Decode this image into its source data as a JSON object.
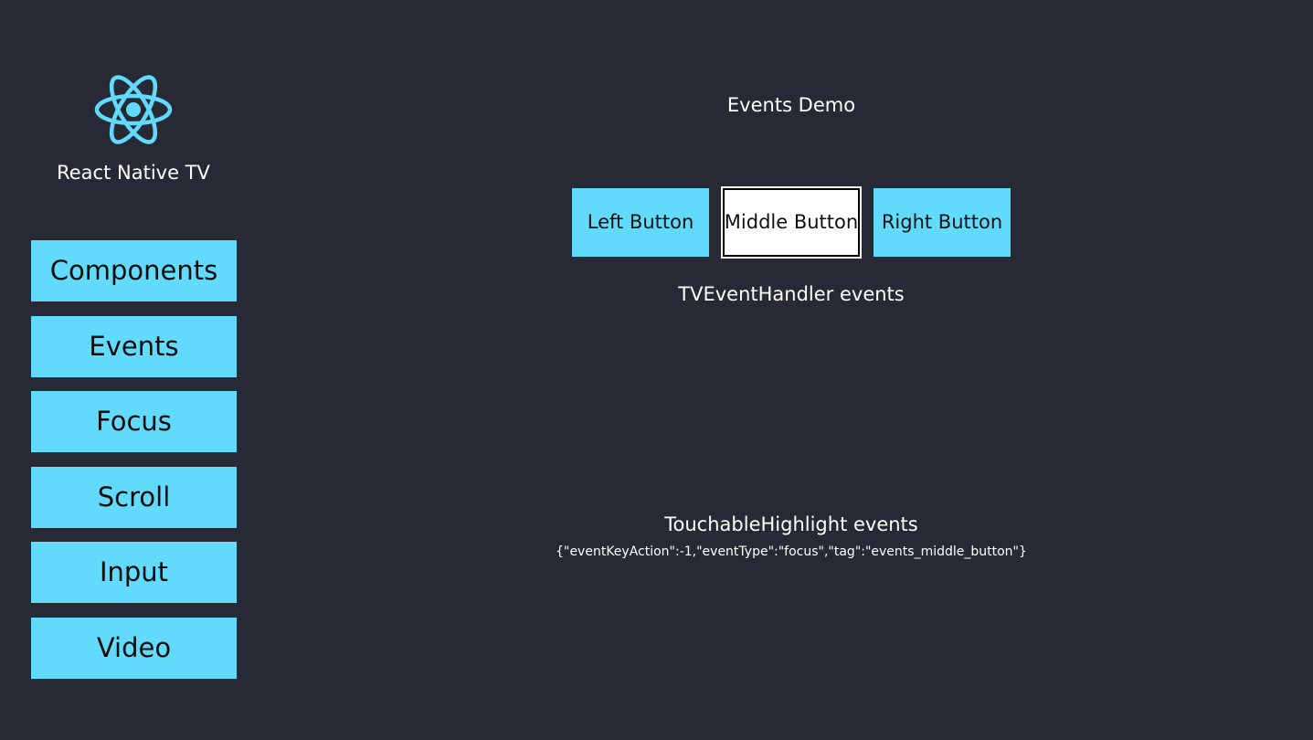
{
  "app": {
    "title": "React Native TV",
    "logo_icon": "react-logo-icon",
    "accent_color": "#61dafb",
    "background_color": "#272a35"
  },
  "sidebar": {
    "items": [
      {
        "label": "Components"
      },
      {
        "label": "Events"
      },
      {
        "label": "Focus"
      },
      {
        "label": "Scroll"
      },
      {
        "label": "Input"
      },
      {
        "label": "Video"
      }
    ]
  },
  "main": {
    "title": "Events Demo",
    "buttons": {
      "left": "Left Button",
      "middle": "Middle Button",
      "right": "Right Button"
    },
    "focused_button": "middle",
    "tv_event_handler_label": "TVEventHandler events",
    "touchable_highlight_label": "TouchableHighlight events",
    "touchable_highlight_event": "{\"eventKeyAction\":-1,\"eventType\":\"focus\",\"tag\":\"events_middle_button\"}"
  }
}
